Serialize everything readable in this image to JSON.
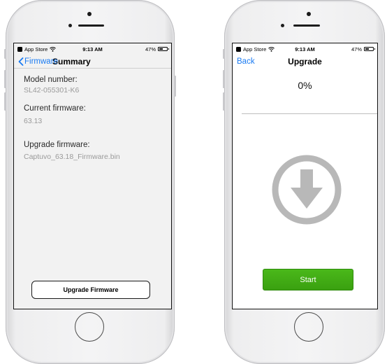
{
  "statusbar": {
    "carrier": "App Store",
    "time": "9:13 AM",
    "battery": "47%",
    "battery_level": 0.47
  },
  "left_screen": {
    "back_label": "Firmware",
    "title": "Summary",
    "model_label": "Model number:",
    "model_value": "SL42-055301-K6",
    "current_label": "Current firmware:",
    "current_value": "63.13",
    "upgrade_label": "Upgrade firmware:",
    "upgrade_value": "Captuvo_63.18_Firmware.bin",
    "button_label": "Upgrade Firmware"
  },
  "right_screen": {
    "back_label": "Back",
    "title": "Upgrade",
    "progress_text": "0%",
    "progress": 0,
    "icon": "download-arrow-icon",
    "start_label": "Start"
  },
  "colors": {
    "link_blue": "#1a7bf2",
    "start_green": "#43ad14",
    "icon_gray": "#b8b8b8"
  }
}
